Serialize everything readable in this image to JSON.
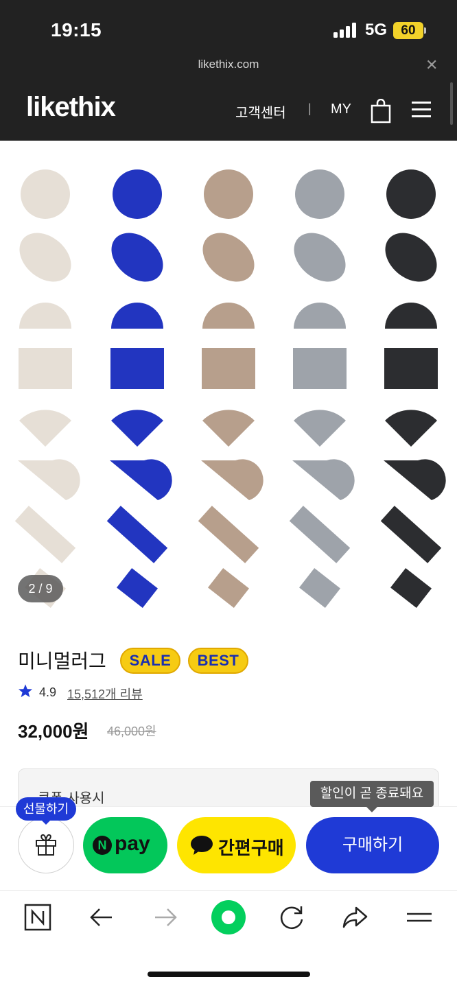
{
  "status_bar": {
    "time": "19:15",
    "network": "5G",
    "battery": "60"
  },
  "browser": {
    "url": "likethix.com",
    "close_icon": "close-icon"
  },
  "header": {
    "logo": "likethix",
    "customer_center": "고객센터",
    "separator": "|",
    "my": "MY",
    "icons": [
      "shopping-bag-icon",
      "hamburger-menu-icon"
    ]
  },
  "gallery": {
    "counter": "2 / 9",
    "colors": [
      "#e6dfd6",
      "#2235c0",
      "#b79f8c",
      "#9ea3aa",
      "#2c2d30"
    ],
    "shapes": [
      "circle",
      "oval",
      "half-circle",
      "rectangle",
      "fan",
      "half-oval",
      "long-runner",
      "small-diamond"
    ]
  },
  "product": {
    "name": "미니멀러그",
    "badges": [
      "SALE",
      "BEST"
    ],
    "rating": "4.9",
    "review_count": "15,512개 리뷰",
    "price": "32,000원",
    "original_price": "46,000원"
  },
  "coupon": {
    "label": "쿠폰 사용시",
    "tooltip": "할인이 곧 종료돼요"
  },
  "actions": {
    "gift_tag": "선물하기",
    "npay_letter": "N",
    "npay_label": "pay",
    "kakao_label": "간편구매",
    "buy_label": "구매하기"
  },
  "toolbar": {
    "icons": [
      "naver-home-icon",
      "back-arrow-icon",
      "forward-arrow-icon",
      "green-dot-icon",
      "refresh-icon",
      "share-icon",
      "menu-lines-icon"
    ]
  }
}
